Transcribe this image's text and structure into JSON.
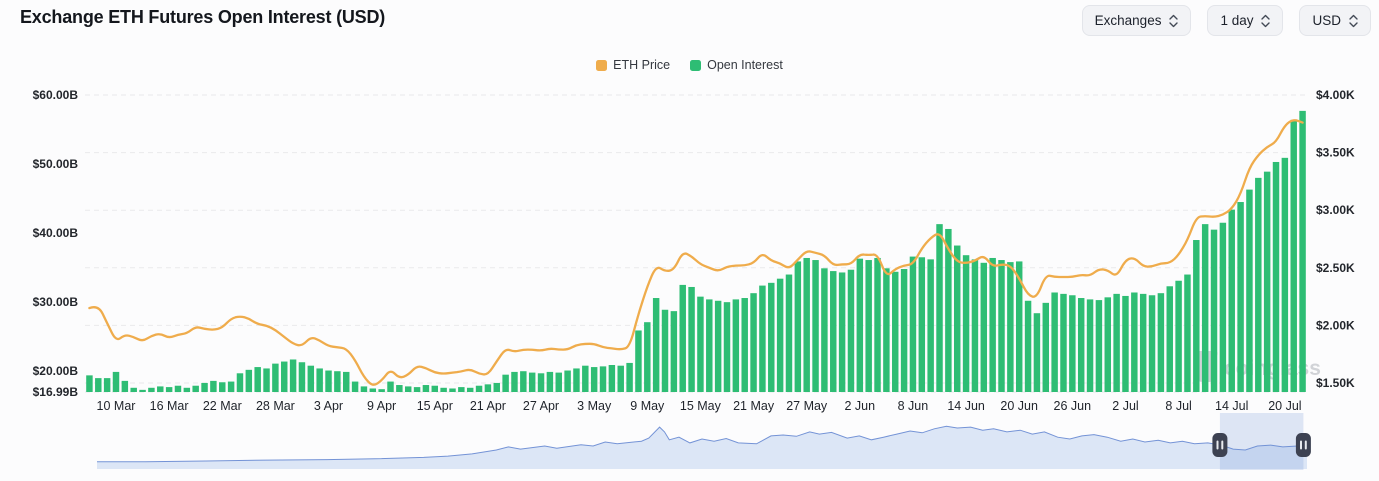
{
  "header": {
    "title": "Exchange ETH Futures Open Interest (USD)"
  },
  "controls": [
    {
      "label": "Exchanges"
    },
    {
      "label": "1 day"
    },
    {
      "label": "USD"
    }
  ],
  "legend": [
    {
      "label": "ETH Price",
      "color": "#EFAC4C"
    },
    {
      "label": "Open Interest",
      "color": "#2EBD74"
    }
  ],
  "watermark": {
    "text": "coinglass"
  },
  "chart_data": {
    "type": "combo",
    "title": "Exchange ETH Futures Open Interest (USD)",
    "n_points": 138,
    "x_start_date": "7 Mar",
    "x_end_date": "22 Jul",
    "x_ticks": [
      {
        "label": "10 Mar",
        "i": 3
      },
      {
        "label": "16 Mar",
        "i": 9
      },
      {
        "label": "22 Mar",
        "i": 15
      },
      {
        "label": "28 Mar",
        "i": 21
      },
      {
        "label": "3 Apr",
        "i": 27
      },
      {
        "label": "9 Apr",
        "i": 33
      },
      {
        "label": "15 Apr",
        "i": 39
      },
      {
        "label": "21 Apr",
        "i": 45
      },
      {
        "label": "27 Apr",
        "i": 51
      },
      {
        "label": "3 May",
        "i": 57
      },
      {
        "label": "9 May",
        "i": 63
      },
      {
        "label": "15 May",
        "i": 69
      },
      {
        "label": "21 May",
        "i": 75
      },
      {
        "label": "27 May",
        "i": 81
      },
      {
        "label": "2 Jun",
        "i": 87
      },
      {
        "label": "8 Jun",
        "i": 93
      },
      {
        "label": "14 Jun",
        "i": 99
      },
      {
        "label": "20 Jun",
        "i": 105
      },
      {
        "label": "26 Jun",
        "i": 111
      },
      {
        "label": "2 Jul",
        "i": 117
      },
      {
        "label": "8 Jul",
        "i": 123
      },
      {
        "label": "14 Jul",
        "i": 129
      },
      {
        "label": "20 Jul",
        "i": 135
      }
    ],
    "left_axis": {
      "title": "Open Interest (USD billions)",
      "tick_labels": [
        "$60.00B",
        "$50.00B",
        "$40.00B",
        "$30.00B",
        "$20.00B",
        "$16.99B"
      ],
      "tick_values": [
        60,
        50,
        40,
        30,
        20,
        16.99
      ],
      "min": 16.99,
      "max": 60.9
    },
    "right_axis": {
      "title": "ETH Price (USD thousands)",
      "tick_labels": [
        "$4.00K",
        "$3.50K",
        "$3.00K",
        "$2.50K",
        "$2.00K",
        "$1.50K"
      ],
      "tick_values": [
        4.0,
        3.5,
        3.0,
        2.5,
        2.0,
        1.5
      ],
      "min": 1.5,
      "max": 4.06
    },
    "grid": {
      "horizontal_dashed": true
    },
    "series": [
      {
        "name": "Open Interest",
        "type": "bar",
        "axis": "left",
        "unit": "$B",
        "color": "#2EBD74",
        "values": [
          19.4,
          19.0,
          19.0,
          19.9,
          18.6,
          17.6,
          17.3,
          17.6,
          17.8,
          17.7,
          17.9,
          17.6,
          17.9,
          18.3,
          18.6,
          18.4,
          18.5,
          19.7,
          20.2,
          20.6,
          20.4,
          21.1,
          21.4,
          21.7,
          21.3,
          20.8,
          20.4,
          20.1,
          20.0,
          19.9,
          18.5,
          17.8,
          17.5,
          17.4,
          18.5,
          18.0,
          17.8,
          17.7,
          18.0,
          17.9,
          17.6,
          17.5,
          17.7,
          17.6,
          17.9,
          18.1,
          18.3,
          19.5,
          19.9,
          20.0,
          19.8,
          19.7,
          19.9,
          19.8,
          20.1,
          20.4,
          20.8,
          20.6,
          20.7,
          20.9,
          20.8,
          21.2,
          25.9,
          27.1,
          30.6,
          28.9,
          28.7,
          32.5,
          32.2,
          30.8,
          30.4,
          30.2,
          30.0,
          30.4,
          30.6,
          31.3,
          32.4,
          32.8,
          33.4,
          34.0,
          35.9,
          36.4,
          36.1,
          34.9,
          34.5,
          34.3,
          34.7,
          36.3,
          36.1,
          36.4,
          34.9,
          34.4,
          34.8,
          36.6,
          36.5,
          36.2,
          41.3,
          40.6,
          38.2,
          36.8,
          36.2,
          35.7,
          36.4,
          36.1,
          35.8,
          35.9,
          30.2,
          28.4,
          29.9,
          31.4,
          31.2,
          31.0,
          30.6,
          30.4,
          30.3,
          30.7,
          31.2,
          30.9,
          31.4,
          31.2,
          31.0,
          31.3,
          32.3,
          33.1,
          34.0,
          39.0,
          41.3,
          40.5,
          41.5,
          43.4,
          44.5,
          46.3,
          48.0,
          48.9,
          50.3,
          50.9,
          56.4,
          57.7
        ]
      },
      {
        "name": "ETH Price",
        "type": "line",
        "axis": "right",
        "unit": "$K",
        "color": "#EFAC4C",
        "values": [
          2.15,
          2.18,
          2.02,
          1.86,
          1.92,
          1.9,
          1.86,
          1.91,
          1.93,
          1.89,
          1.92,
          1.93,
          1.99,
          1.97,
          1.96,
          1.98,
          2.06,
          2.08,
          2.06,
          2.01,
          2.0,
          1.96,
          1.9,
          1.84,
          1.82,
          1.9,
          1.87,
          1.82,
          1.81,
          1.8,
          1.7,
          1.55,
          1.47,
          1.52,
          1.62,
          1.54,
          1.57,
          1.65,
          1.63,
          1.59,
          1.58,
          1.59,
          1.6,
          1.62,
          1.58,
          1.57,
          1.69,
          1.8,
          1.77,
          1.79,
          1.79,
          1.78,
          1.8,
          1.79,
          1.79,
          1.83,
          1.84,
          1.84,
          1.81,
          1.8,
          1.79,
          1.81,
          2.1,
          2.34,
          2.52,
          2.47,
          2.48,
          2.64,
          2.6,
          2.53,
          2.5,
          2.47,
          2.51,
          2.52,
          2.52,
          2.54,
          2.63,
          2.56,
          2.54,
          2.49,
          2.57,
          2.65,
          2.63,
          2.61,
          2.52,
          2.53,
          2.53,
          2.62,
          2.61,
          2.62,
          2.42,
          2.49,
          2.52,
          2.53,
          2.67,
          2.76,
          2.81,
          2.66,
          2.55,
          2.54,
          2.56,
          2.61,
          2.51,
          2.53,
          2.52,
          2.41,
          2.26,
          2.24,
          2.44,
          2.42,
          2.42,
          2.42,
          2.44,
          2.43,
          2.49,
          2.48,
          2.42,
          2.57,
          2.59,
          2.51,
          2.51,
          2.54,
          2.54,
          2.61,
          2.74,
          2.94,
          2.95,
          2.94,
          2.96,
          3.01,
          3.14,
          3.37,
          3.48,
          3.55,
          3.59,
          3.74,
          3.79,
          3.76
        ]
      }
    ]
  },
  "navigator": {
    "selection": {
      "from_frac": 0.928,
      "to_frac": 0.997
    },
    "line_color": "#7493d6",
    "fill_color": "#dce6f6",
    "points": [
      [
        0,
        0.14
      ],
      [
        0.04,
        0.14
      ],
      [
        0.09,
        0.16
      ],
      [
        0.14,
        0.18
      ],
      [
        0.19,
        0.19
      ],
      [
        0.23,
        0.21
      ],
      [
        0.27,
        0.24
      ],
      [
        0.29,
        0.27
      ],
      [
        0.31,
        0.32
      ],
      [
        0.33,
        0.41
      ],
      [
        0.34,
        0.48
      ],
      [
        0.35,
        0.43
      ],
      [
        0.37,
        0.5
      ],
      [
        0.38,
        0.45
      ],
      [
        0.4,
        0.53
      ],
      [
        0.41,
        0.5
      ],
      [
        0.42,
        0.59
      ],
      [
        0.43,
        0.55
      ],
      [
        0.45,
        0.61
      ],
      [
        0.456,
        0.68
      ],
      [
        0.465,
        0.93
      ],
      [
        0.469,
        0.82
      ],
      [
        0.473,
        0.64
      ],
      [
        0.481,
        0.7
      ],
      [
        0.49,
        0.57
      ],
      [
        0.5,
        0.66
      ],
      [
        0.51,
        0.61
      ],
      [
        0.52,
        0.67
      ],
      [
        0.53,
        0.57
      ],
      [
        0.545,
        0.55
      ],
      [
        0.557,
        0.73
      ],
      [
        0.567,
        0.75
      ],
      [
        0.578,
        0.72
      ],
      [
        0.589,
        0.82
      ],
      [
        0.597,
        0.77
      ],
      [
        0.607,
        0.81
      ],
      [
        0.62,
        0.68
      ],
      [
        0.63,
        0.73
      ],
      [
        0.64,
        0.64
      ],
      [
        0.65,
        0.7
      ],
      [
        0.661,
        0.77
      ],
      [
        0.672,
        0.84
      ],
      [
        0.682,
        0.8
      ],
      [
        0.692,
        0.89
      ],
      [
        0.702,
        0.95
      ],
      [
        0.711,
        0.91
      ],
      [
        0.722,
        0.93
      ],
      [
        0.732,
        0.86
      ],
      [
        0.741,
        0.89
      ],
      [
        0.752,
        0.82
      ],
      [
        0.763,
        0.86
      ],
      [
        0.773,
        0.77
      ],
      [
        0.783,
        0.82
      ],
      [
        0.794,
        0.7
      ],
      [
        0.804,
        0.66
      ],
      [
        0.814,
        0.73
      ],
      [
        0.824,
        0.76
      ],
      [
        0.835,
        0.7
      ],
      [
        0.846,
        0.61
      ],
      [
        0.856,
        0.66
      ],
      [
        0.866,
        0.59
      ],
      [
        0.877,
        0.63
      ],
      [
        0.887,
        0.57
      ],
      [
        0.897,
        0.61
      ],
      [
        0.907,
        0.55
      ],
      [
        0.918,
        0.57
      ],
      [
        0.929,
        0.52
      ],
      [
        0.939,
        0.43
      ],
      [
        0.949,
        0.41
      ],
      [
        0.959,
        0.5
      ],
      [
        0.97,
        0.52
      ],
      [
        0.98,
        0.48
      ],
      [
        0.992,
        0.5
      ],
      [
        1,
        0.48
      ]
    ]
  }
}
